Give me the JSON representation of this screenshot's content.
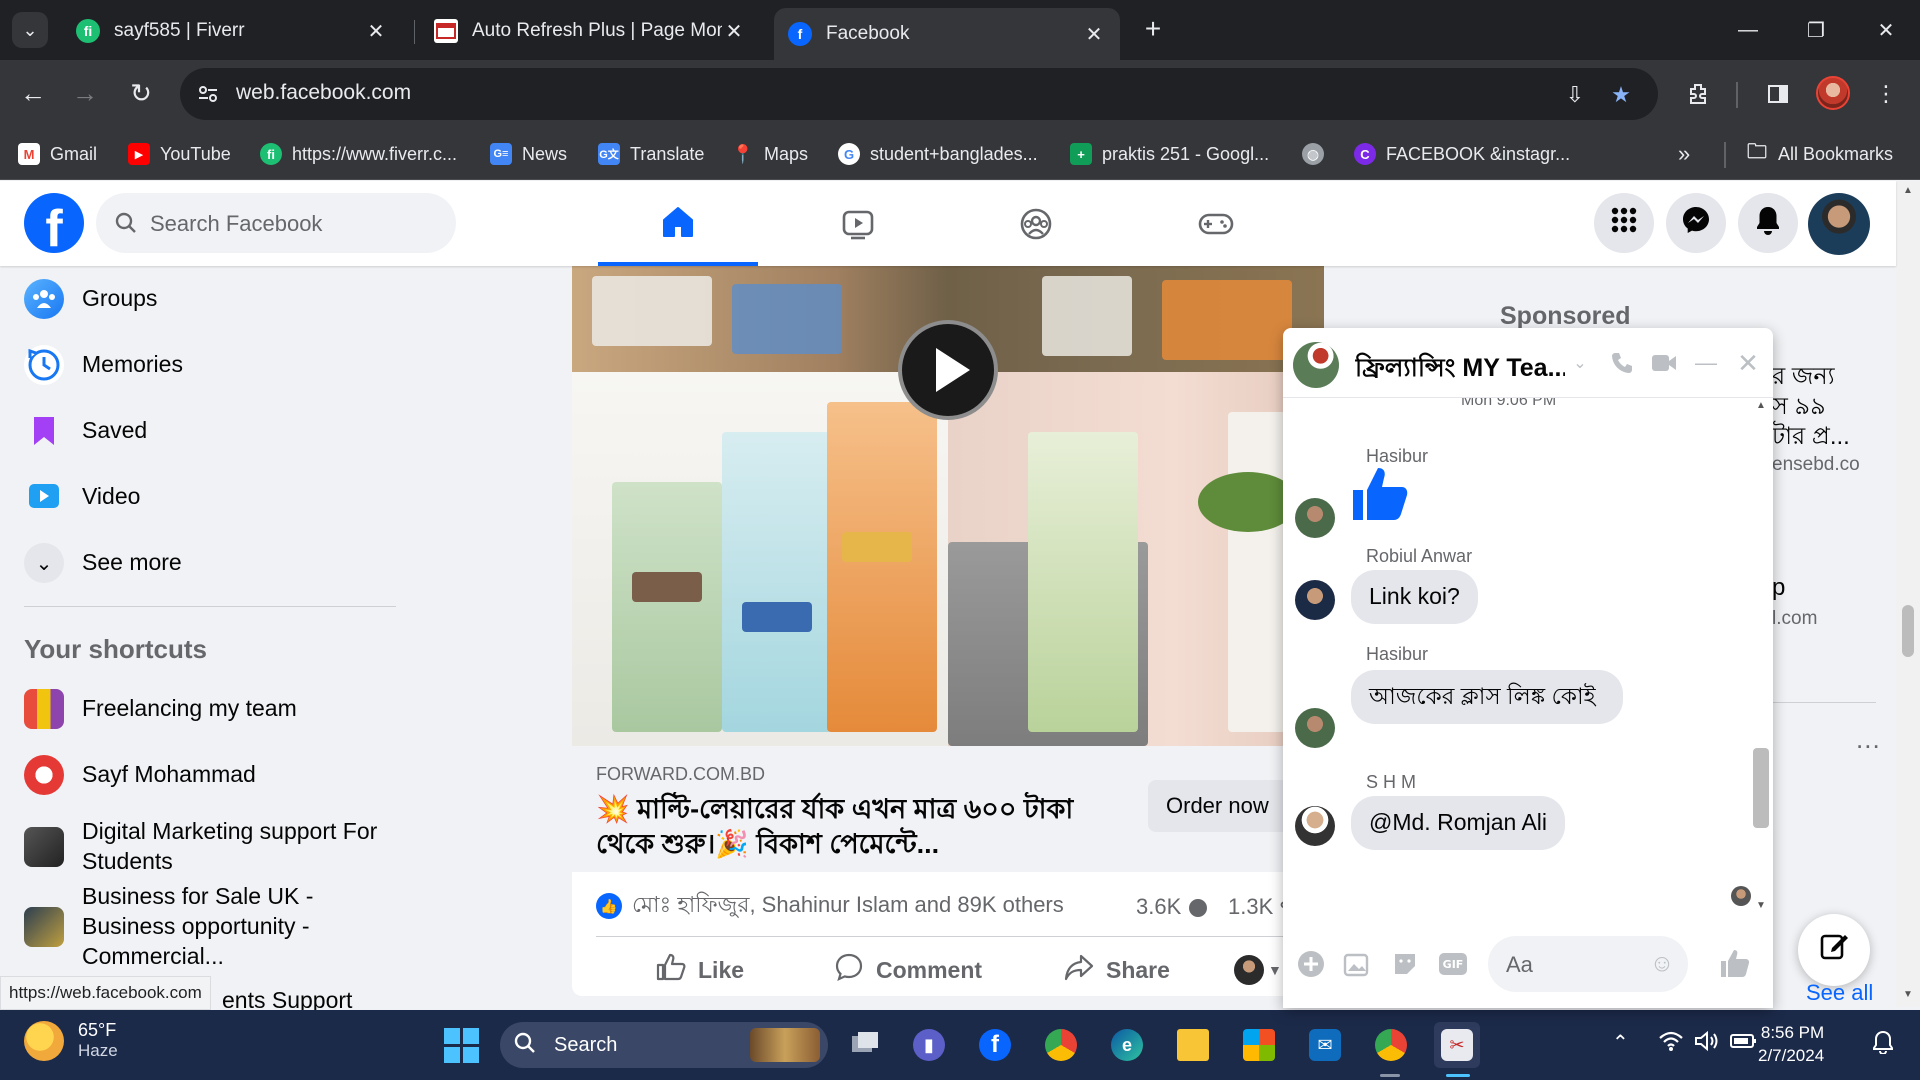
{
  "browser": {
    "tabs": [
      {
        "title": "sayf585 | Fiverr",
        "favicon": "fiverr-icon",
        "active": false
      },
      {
        "title": "Auto Refresh Plus | Page Monito",
        "favicon": "auto-refresh-icon",
        "active": false
      },
      {
        "title": "Facebook",
        "favicon": "facebook-icon",
        "active": true
      }
    ],
    "url": "web.facebook.com",
    "bookmarks": [
      {
        "label": "Gmail",
        "icon": "gmail-icon"
      },
      {
        "label": "YouTube",
        "icon": "youtube-icon"
      },
      {
        "label": "https://www.fiverr.c...",
        "icon": "fiverr-icon"
      },
      {
        "label": "News",
        "icon": "news-icon"
      },
      {
        "label": "Translate",
        "icon": "translate-icon"
      },
      {
        "label": "Maps",
        "icon": "maps-icon"
      },
      {
        "label": "student+banglades...",
        "icon": "google-icon"
      },
      {
        "label": "praktis 251 - Googl...",
        "icon": "sheets-icon"
      },
      {
        "label": "",
        "icon": "globe-icon"
      },
      {
        "label": "FACEBOOK &instagr...",
        "icon": "canva-icon"
      }
    ],
    "more_bookmarks": "»",
    "all_bookmarks": "All Bookmarks",
    "status_url": "https://web.facebook.com"
  },
  "facebook": {
    "search_placeholder": "Search Facebook",
    "left_nav": [
      {
        "label": "Groups",
        "icon": "groups-icon"
      },
      {
        "label": "Memories",
        "icon": "memories-icon"
      },
      {
        "label": "Saved",
        "icon": "saved-icon"
      },
      {
        "label": "Video",
        "icon": "video-icon"
      },
      {
        "label": "See more",
        "icon": "chevron-down-icon"
      }
    ],
    "shortcuts_title": "Your shortcuts",
    "shortcuts": [
      {
        "label": "Freelancing my team"
      },
      {
        "label": "Sayf Mohammad"
      },
      {
        "label": "Digital Marketing support For Students"
      },
      {
        "label": "Business for Sale UK - Business opportunity - Commercial..."
      },
      {
        "label": "ents Support"
      }
    ],
    "post": {
      "domain": "FORWARD.COM.BD",
      "headline": "💥 মাল্টি-লেয়ারের র্যাক এখন মাত্র ৬০০ টাকা থেকে শুরু।🎉 বিকাশ পেমেন্টে...",
      "cta": "Order now",
      "reactions_text": "মোঃ হাফিজুর, Shahinur Islam and 89K others",
      "comments_count": "3.6K",
      "shares_count": "1.3K",
      "actions": {
        "like": "Like",
        "comment": "Comment",
        "share": "Share"
      }
    },
    "right_col": {
      "sponsored": "Sponsored",
      "ad_line1": "র জন্য",
      "ad_line2": "স ৯৯",
      "ad_line3": "টার প্র...",
      "ad_domain": "ensebd.co",
      "ad2_line": "p",
      "ad2_domain": "l.com",
      "more": "...",
      "see_all": "See all"
    },
    "chat": {
      "group_name": "ফ্রিল্যান্সিং MY Tea...",
      "timestamp": "Mon 9:06 PM",
      "messages": [
        {
          "sender": "Hasibur",
          "text": "👍",
          "type": "like"
        },
        {
          "sender": "Robiul Anwar",
          "text": "Link koi?"
        },
        {
          "sender": "Hasibur",
          "text": "আজকের ক্লাস লিঙ্ক কোই"
        },
        {
          "sender": "S H M",
          "text": "@Md. Romjan Ali"
        }
      ],
      "input_placeholder": "Aa"
    }
  },
  "taskbar": {
    "temperature": "65°F",
    "condition": "Haze",
    "search_placeholder": "Search",
    "time": "8:56 PM",
    "date": "2/7/2024"
  }
}
